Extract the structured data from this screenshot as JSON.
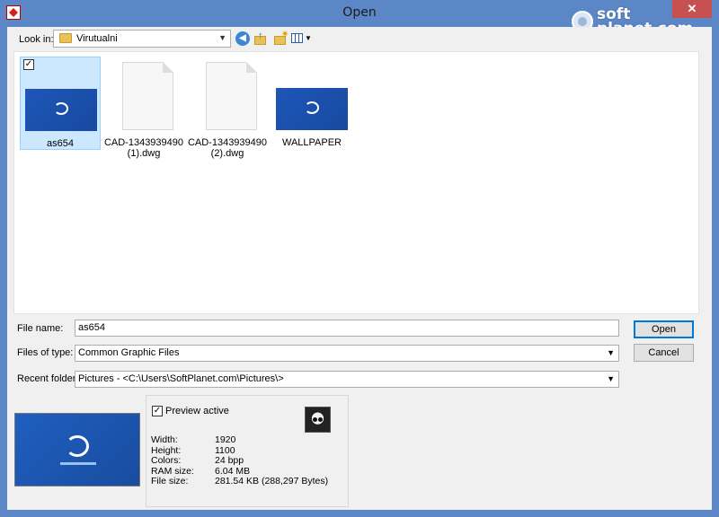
{
  "window": {
    "title": "Open",
    "close_glyph": "✕",
    "accent_color": "#5b87c7"
  },
  "watermark": {
    "line1": "soft",
    "line2": "planet.com"
  },
  "toolbar": {
    "look_in_label": "Look in:",
    "look_in_value": "Virutualni",
    "icons": [
      "back-icon",
      "up-folder-icon",
      "new-folder-icon",
      "view-menu-icon"
    ]
  },
  "files": [
    {
      "line1": "as654",
      "line2": "",
      "kind": "image",
      "selected": true,
      "checked": true
    },
    {
      "line1": "CAD-1343939490",
      "line2": "(1).dwg",
      "kind": "document",
      "selected": false,
      "checked": false
    },
    {
      "line1": "CAD-1343939490",
      "line2": "(2).dwg",
      "kind": "document",
      "selected": false,
      "checked": false
    },
    {
      "line1": "WALLPAPER",
      "line2": "",
      "kind": "image",
      "selected": false,
      "checked": false
    }
  ],
  "form": {
    "file_name_label": "File name:",
    "file_name_value": "as654",
    "file_type_label": "Files of type:",
    "file_type_value": "Common Graphic Files",
    "recent_label": "Recent folders:",
    "recent_value": "Pictures  -  <C:\\Users\\SoftPlanet.com\\Pictures\\>",
    "open_button": "Open",
    "cancel_button": "Cancel"
  },
  "preview": {
    "active_label": "Preview active",
    "active_checked": true,
    "width_label": "Width:",
    "width_value": "1920",
    "height_label": "Height:",
    "height_value": "1100",
    "colors_label": "Colors:",
    "colors_value": "24 bpp",
    "ram_label": "RAM size:",
    "ram_value": "6.04 MB",
    "filesize_label": "File size:",
    "filesize_value": "281.54 KB (288,297 Bytes)"
  }
}
